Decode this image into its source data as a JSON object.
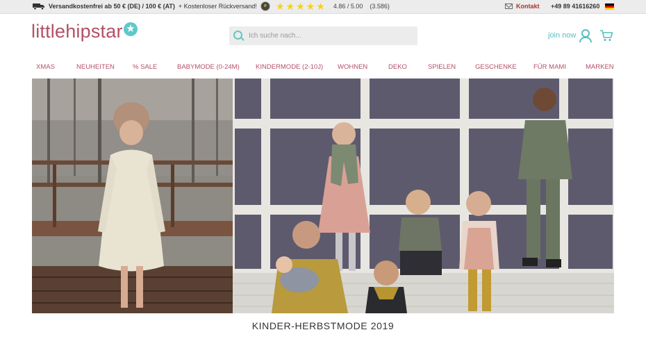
{
  "topbar": {
    "shipping_bold": "Versandkostenfrei ab 50 € (DE) / 100 € (AT)",
    "shipping_rest": "+ Kostenloser Rückversand!",
    "rating_score": "4.86 / 5.00",
    "rating_count": "(3.586)",
    "contact_label": "Kontakt",
    "phone": "+49 89 41616260",
    "seal_text": "e"
  },
  "header": {
    "logo_text": "littlehipstar",
    "logo_star": "★",
    "search_placeholder": "Ich suche nach...",
    "join_label": "join now"
  },
  "nav": {
    "items": [
      {
        "label": "XMAS"
      },
      {
        "label": "NEUHEITEN"
      },
      {
        "label": "% SALE"
      },
      {
        "label": "BABYMODE (0-24M)"
      },
      {
        "label": "KINDERMODE (2-10J)"
      },
      {
        "label": "WOHNEN"
      },
      {
        "label": "DEKO"
      },
      {
        "label": "SPIELEN"
      },
      {
        "label": "GESCHENKE"
      },
      {
        "label": "FÜR MAMI"
      },
      {
        "label": "MARKEN"
      }
    ]
  },
  "hero": {
    "caption": "KINDER-HERBSTMODE 2019"
  },
  "colors": {
    "brand": "#b3506a",
    "accent": "#55bfbf",
    "star": "#f7d117",
    "contact": "#b03030"
  },
  "icons": [
    "truck-icon",
    "trusted-seal-icon",
    "star-icon",
    "mail-icon",
    "flag-de-icon",
    "search-icon",
    "user-icon",
    "cart-icon"
  ]
}
